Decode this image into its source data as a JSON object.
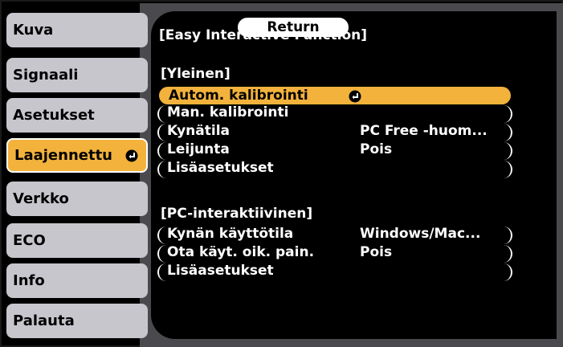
{
  "sidebar": {
    "items": [
      {
        "label": "Kuva"
      },
      {
        "label": "Signaali"
      },
      {
        "label": "Asetukset"
      },
      {
        "label": "Laajennettu"
      },
      {
        "label": "Verkko"
      },
      {
        "label": "ECO"
      },
      {
        "label": "Info"
      },
      {
        "label": "Palauta"
      }
    ],
    "active_index": 3
  },
  "header": {
    "title": "[Easy Interactive Function]",
    "return_label": "Return"
  },
  "general": {
    "heading": "[Yleinen]",
    "rows": [
      {
        "label": "Autom. kalibrointi",
        "value": ""
      },
      {
        "label": "Man. kalibrointi",
        "value": ""
      },
      {
        "label": "Kynätila",
        "value": "PC Free -huom..."
      },
      {
        "label": "Leijunta",
        "value": "Pois"
      },
      {
        "label": "Lisäasetukset",
        "value": ""
      }
    ]
  },
  "pc_interactive": {
    "heading": "[PC-interaktiivinen]",
    "rows": [
      {
        "label": "Kynän käyttötila",
        "value": "Windows/Mac..."
      },
      {
        "label": "Ota käyt. oik. pain.",
        "value": "Pois"
      },
      {
        "label": "Lisäasetukset",
        "value": ""
      }
    ]
  },
  "colors": {
    "highlight": "#f2b23c",
    "sidebar_item": "#c7c6cd",
    "background": "#000000"
  },
  "icons": {
    "enter": "enter-icon"
  }
}
